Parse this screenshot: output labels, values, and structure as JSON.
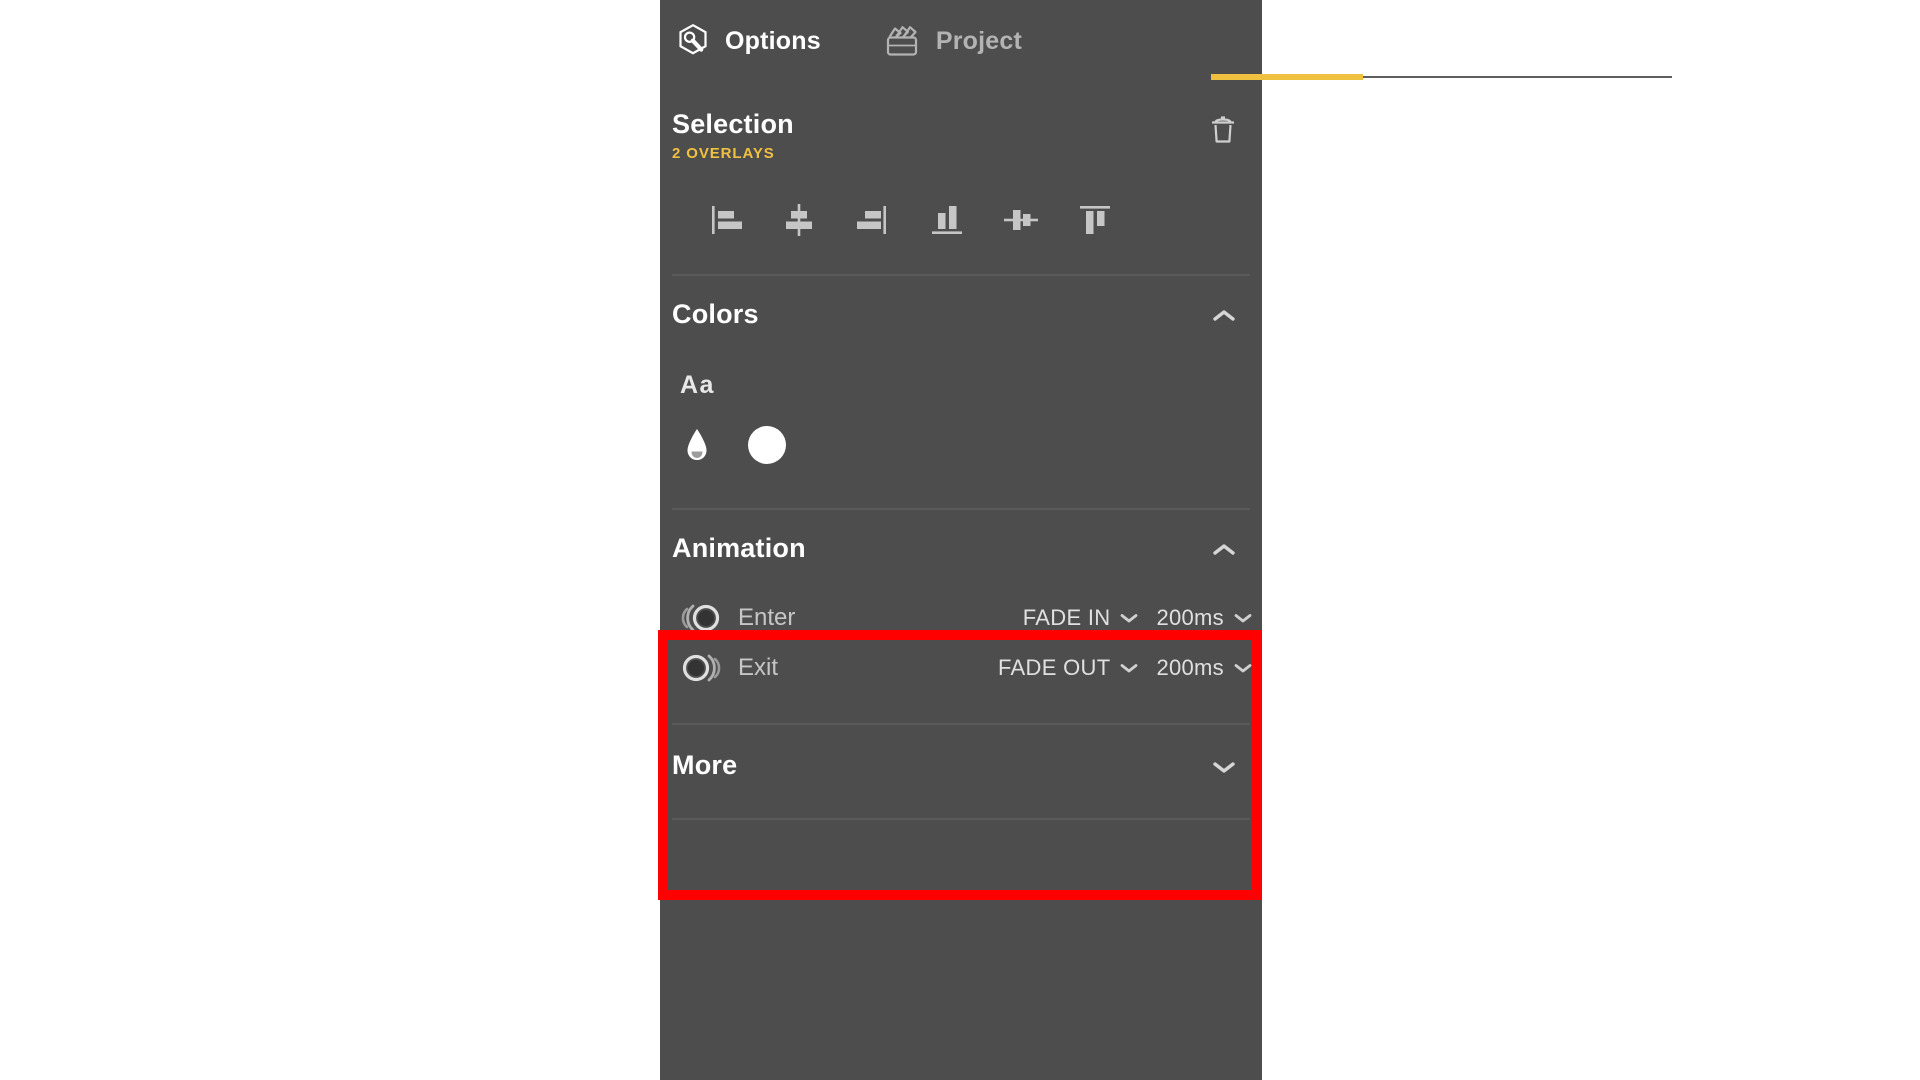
{
  "panel": {
    "background_color": "#4d4d4d",
    "accent_color": "#f0c040",
    "highlight_color": "#ff0000"
  },
  "tabs": [
    {
      "label": "Options",
      "icon": "wrench-hexagon-icon",
      "active": true
    },
    {
      "label": "Project",
      "icon": "clapperboard-icon",
      "active": false
    }
  ],
  "selection": {
    "title": "Selection",
    "subtitle": "2 OVERLAYS",
    "delete_icon": "trash-icon",
    "align_buttons": [
      {
        "name": "align-left-icon"
      },
      {
        "name": "align-center-horizontal-icon"
      },
      {
        "name": "align-right-icon"
      },
      {
        "name": "align-bottom-icon"
      },
      {
        "name": "align-middle-vertical-icon"
      },
      {
        "name": "align-top-icon"
      }
    ]
  },
  "colors": {
    "title": "Colors",
    "collapse_icon": "chevron-up-icon",
    "expanded": true,
    "font_preview": "Aa",
    "swatches": [
      {
        "name": "opacity-droplet-icon",
        "color": "#ffffff"
      },
      {
        "name": "color-swatch",
        "color": "#ffffff"
      }
    ]
  },
  "animation": {
    "title": "Animation",
    "collapse_icon": "chevron-up-icon",
    "expanded": true,
    "rows": [
      {
        "label": "Enter",
        "icon": "animation-enter-icon",
        "effect": "FADE IN",
        "duration": "200ms"
      },
      {
        "label": "Exit",
        "icon": "animation-exit-icon",
        "effect": "FADE OUT",
        "duration": "200ms"
      }
    ]
  },
  "more": {
    "title": "More",
    "expand_icon": "chevron-down-icon",
    "expanded": false
  }
}
